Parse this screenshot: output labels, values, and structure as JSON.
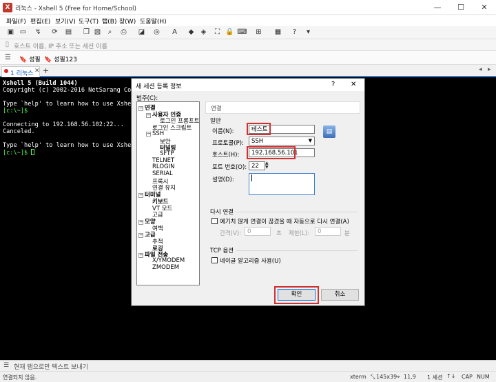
{
  "window": {
    "title": "리눅스 - Xshell 5 (Free for Home/School)",
    "icon": "xshell-icon",
    "min": "—",
    "max": "☐",
    "close": "✕"
  },
  "menu": [
    "파일(F)",
    "편집(E)",
    "보기(V)",
    "도구(T)",
    "탭(B)",
    "창(W)",
    "도움말(H)"
  ],
  "address": {
    "placeholder": "호스트 이름, IP 주소 또는 세션 이름"
  },
  "links": [
    {
      "icon": "bookmark-icon",
      "label": "성필"
    },
    {
      "icon": "bookmark-icon",
      "label": "성필123"
    }
  ],
  "tabs": [
    {
      "label": "1 리눅스",
      "active": true
    }
  ],
  "terminal": {
    "lines": [
      {
        "text": "Xshell 5 (Build 1044)",
        "bold": true
      },
      {
        "text": "Copyright (c) 2002-2016 NetSarang Compu"
      },
      {
        "text": ""
      },
      {
        "text": "Type `help' to learn how to use Xshell"
      },
      {
        "text": "[c:\\~]$",
        "prompt": true
      },
      {
        "text": ""
      },
      {
        "text": "Connecting to 192.168.56.102:22..."
      },
      {
        "text": "Canceled."
      },
      {
        "text": ""
      },
      {
        "text": "Type `help' to learn how to use Xshell"
      },
      {
        "text": "[c:\\~]$ ",
        "prompt": true,
        "cursor": true
      }
    ]
  },
  "send_bar": {
    "text": "현재 탭으로만 텍스트 보내기"
  },
  "status": {
    "left": "연결되지 않음.",
    "term": "xterm",
    "size": "145x39",
    "pos": "11,9",
    "sessions": "1 세션",
    "cap": "CAP",
    "num": "NUM"
  },
  "dialog": {
    "title": "새 세션 등록 정보",
    "help": "?",
    "close": "✕",
    "category_label": "범주(C):",
    "tree": [
      {
        "label": "연결",
        "level": 0,
        "bold": true,
        "exp": "−"
      },
      {
        "label": "사용자 인증",
        "level": 1,
        "bold": true,
        "exp": "−"
      },
      {
        "label": "로그인 프롬프트",
        "level": 2
      },
      {
        "label": "로그인 스크립트",
        "level": 1
      },
      {
        "label": "SSH",
        "level": 1,
        "exp": "−"
      },
      {
        "label": "보안",
        "level": 2
      },
      {
        "label": "터널링",
        "level": 2,
        "bold": true
      },
      {
        "label": "SFTP",
        "level": 2
      },
      {
        "label": "TELNET",
        "level": 1
      },
      {
        "label": "RLOGIN",
        "level": 1
      },
      {
        "label": "SERIAL",
        "level": 1
      },
      {
        "label": "프록시",
        "level": 1
      },
      {
        "label": "연결 유지",
        "level": 1
      },
      {
        "label": "터미널",
        "level": 0,
        "bold": true,
        "exp": "−"
      },
      {
        "label": "키보드",
        "level": 1,
        "bold": true
      },
      {
        "label": "VT 모드",
        "level": 1
      },
      {
        "label": "고급",
        "level": 1
      },
      {
        "label": "모양",
        "level": 0,
        "bold": true,
        "exp": "−"
      },
      {
        "label": "여백",
        "level": 1
      },
      {
        "label": "고급",
        "level": 0,
        "bold": true,
        "exp": "−"
      },
      {
        "label": "추적",
        "level": 1
      },
      {
        "label": "로깅",
        "level": 1,
        "bold": true
      },
      {
        "label": "파일 전송",
        "level": 0,
        "bold": true,
        "exp": "−"
      },
      {
        "label": "X/YMODEM",
        "level": 1
      },
      {
        "label": "ZMODEM",
        "level": 1
      }
    ],
    "section": "연결",
    "general": "일반",
    "name_label": "이름(N):",
    "name_value": "테스트",
    "protocol_label": "프로토콜(P):",
    "protocol_value": "SSH",
    "host_label": "호스트(H):",
    "host_value": "192.168.56.101",
    "port_label": "포트 번호(O):",
    "port_value": "22",
    "desc_label": "설명(D):",
    "reconnect": "다시 연결",
    "reconnect_check": "예기치 않게 연결이 끊겼을 때 자동으로 다시 연결(A)",
    "interval_label": "간격(V):",
    "interval_value": "0",
    "sec": "초",
    "limit_label": "제한(L):",
    "limit_value": "0",
    "min": "분",
    "tcp": "TCP 옵션",
    "nagle": "네이글 알고리즘 사용(U)",
    "ok": "확인",
    "cancel": "취소",
    "highlight_color": "#d32f2f"
  }
}
